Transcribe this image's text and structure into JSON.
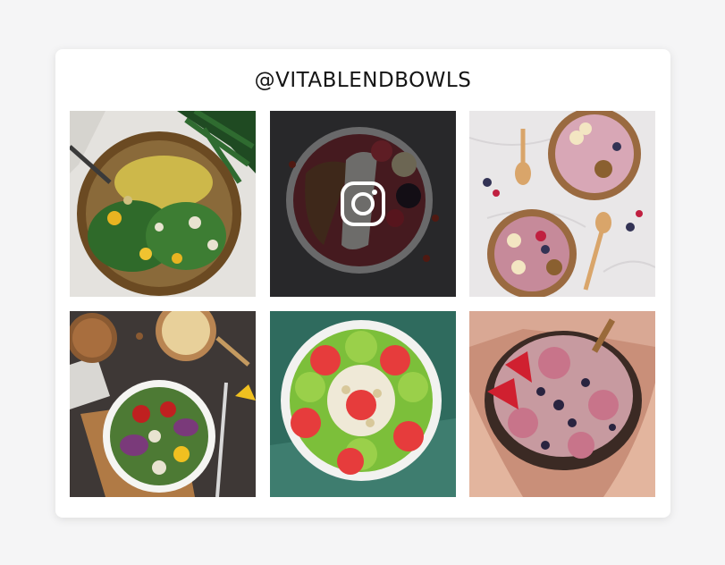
{
  "feed": {
    "handle": "@VITABLENDBOWLS"
  },
  "posts": [
    {
      "subject": "quinoa-vegetable-bowl"
    },
    {
      "subject": "acai-granola-bowl",
      "hovered": true,
      "overlay_icon": "instagram-icon"
    },
    {
      "subject": "berry-smoothie-bowls"
    },
    {
      "subject": "salad-bowl-with-hummus"
    },
    {
      "subject": "kiwi-strawberry-smoothie-bowl"
    },
    {
      "subject": "raspberry-chia-bowl-in-hands"
    }
  ]
}
